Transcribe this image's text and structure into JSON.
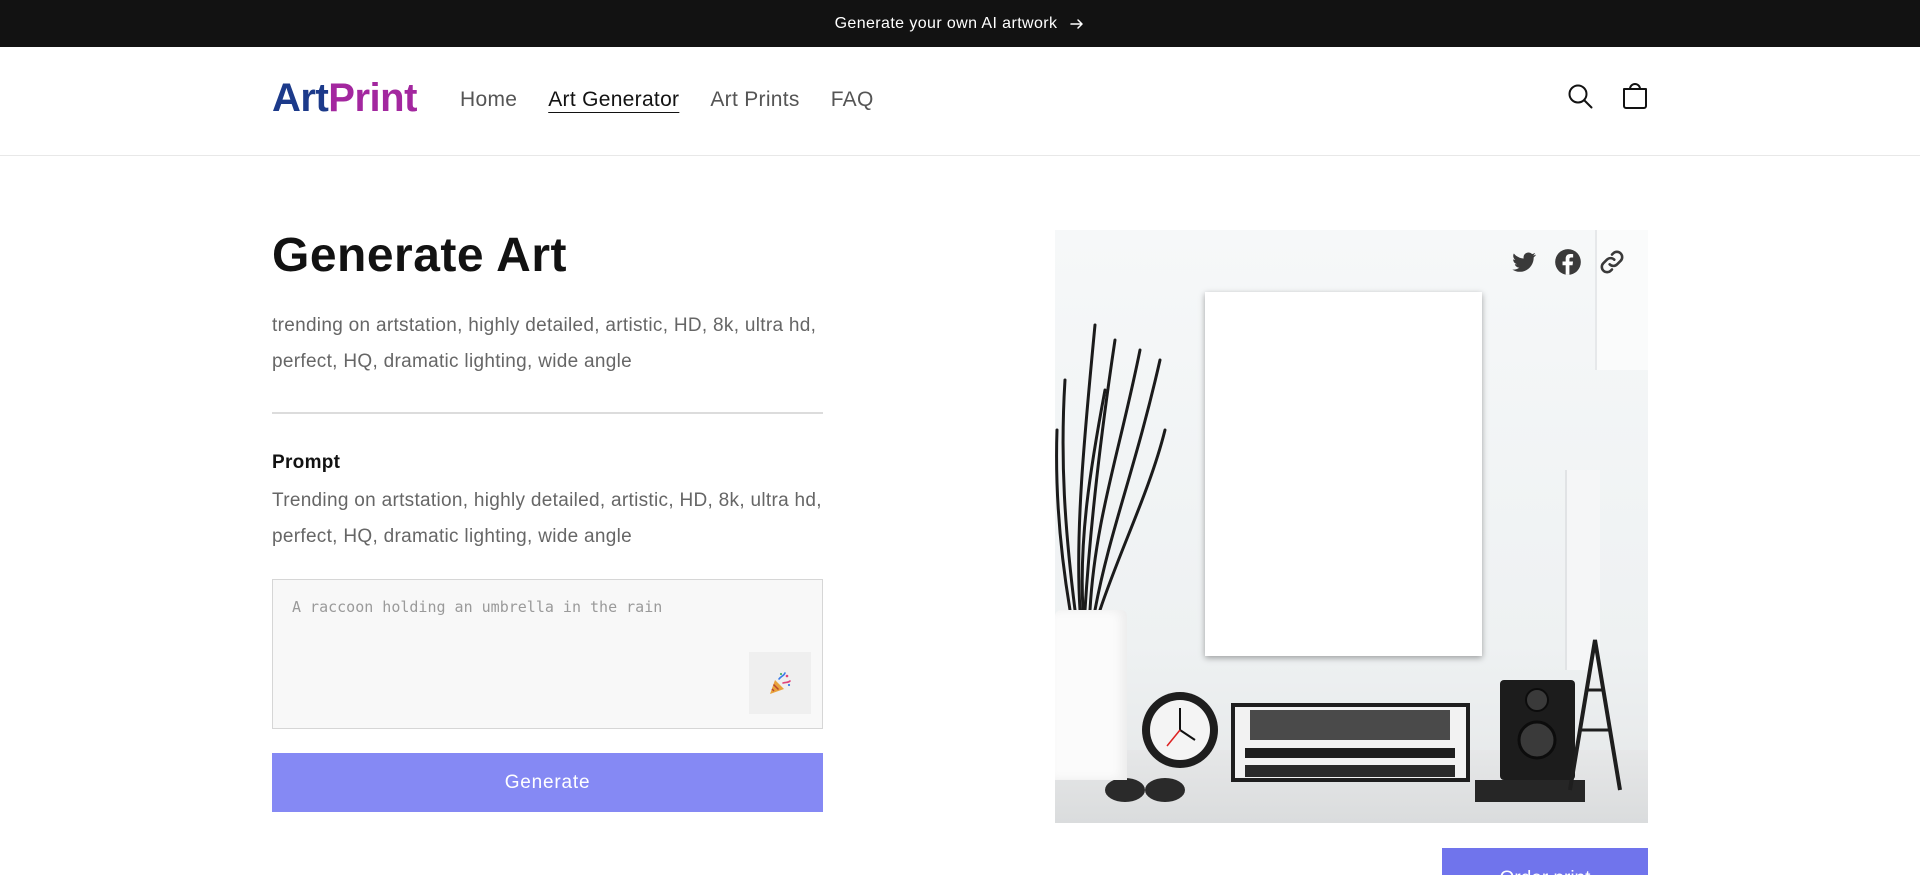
{
  "announcement": {
    "text": "Generate your own AI artwork",
    "icon": "arrow-right-icon"
  },
  "header": {
    "logo_part1": "Art",
    "logo_part2": "Print",
    "nav": [
      {
        "label": "Home",
        "active": false
      },
      {
        "label": "Art Generator",
        "active": true
      },
      {
        "label": "Art Prints",
        "active": false
      },
      {
        "label": "FAQ",
        "active": false
      }
    ],
    "icons": [
      "search-icon",
      "cart-icon"
    ]
  },
  "main": {
    "title": "Generate Art",
    "description": "trending on artstation, highly detailed, artistic, HD, 8k, ultra hd, perfect, HQ, dramatic lighting, wide angle",
    "prompt_label": "Prompt",
    "prompt_help": "Trending on artstation, highly detailed, artistic, HD, 8k, ultra hd, perfect, HQ, dramatic lighting, wide angle",
    "prompt_placeholder": "A raccoon holding an umbrella in the rain",
    "prompt_value": "",
    "random_icon": "party-popper-icon",
    "generate_label": "Generate",
    "order_label": "Order print"
  },
  "share": {
    "icons": [
      "twitter-icon",
      "facebook-icon",
      "link-icon"
    ]
  },
  "colors": {
    "announcement_bg": "#121212",
    "logo_art": "#1c3a8a",
    "logo_print": "#a3279f",
    "generate_button": "#8589f4",
    "order_button": "#7074ec"
  }
}
